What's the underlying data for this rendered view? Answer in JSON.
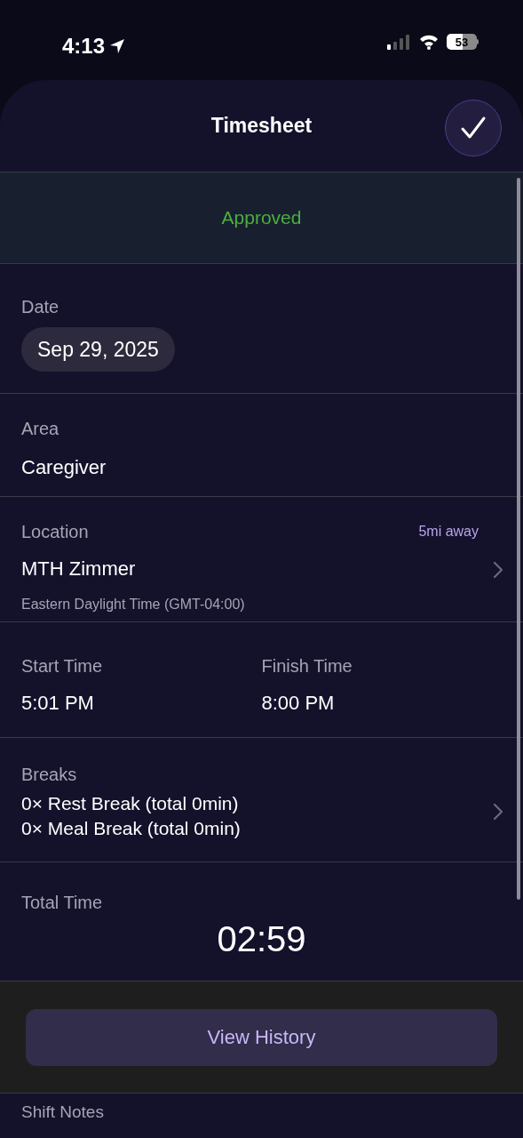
{
  "status_bar": {
    "time": "4:13",
    "battery": "53"
  },
  "header": {
    "title": "Timesheet"
  },
  "status": {
    "label": "Approved"
  },
  "date": {
    "label": "Date",
    "value": "Sep 29, 2025"
  },
  "area": {
    "label": "Area",
    "value": "Caregiver"
  },
  "location": {
    "label": "Location",
    "distance": "5mi away",
    "name": "MTH Zimmer",
    "timezone": "Eastern Daylight Time (GMT-04:00)"
  },
  "times": [
    {
      "label": "Start Time",
      "value": "5:01 PM"
    },
    {
      "label": "Finish Time",
      "value": "8:00 PM"
    }
  ],
  "breaks": {
    "label": "Breaks",
    "lines": [
      "0× Rest Break (total 0min)",
      "0× Meal Break (total 0min)"
    ]
  },
  "total_time": {
    "label": "Total Time",
    "value": "02:59"
  },
  "view_history_button": "View History",
  "shift_notes": {
    "label": "Shift Notes"
  }
}
